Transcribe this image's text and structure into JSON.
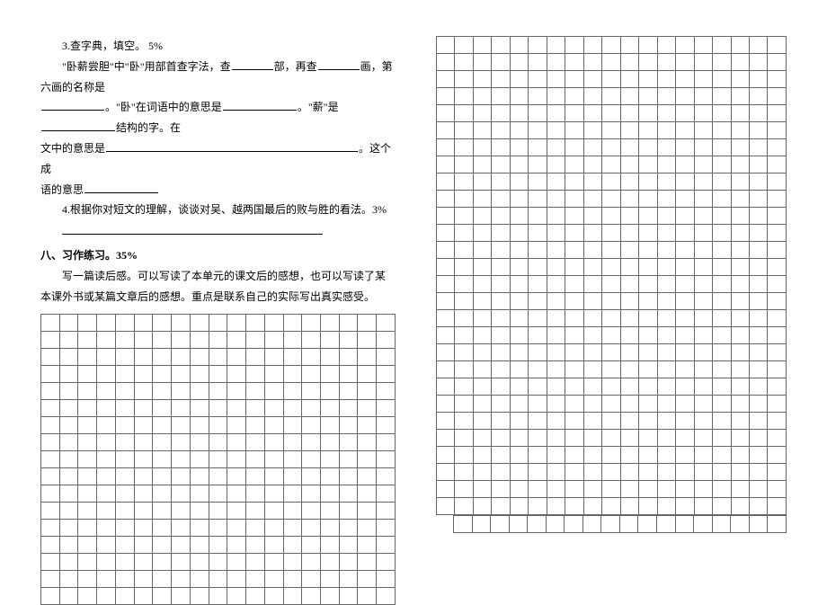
{
  "q3": {
    "label": "3.查字典，填空。 5%",
    "line1a": "\"卧薪尝胆\"中\"卧\"用部首查字法，查",
    "line1b": "部，再查",
    "line1c": "画，第六画的名称是",
    "line2a": "。\"卧\"在词语中的意思是",
    "line2b": "。\"薪\"是",
    "line2c": "结构的字。在",
    "line3a": "文中的意思是",
    "line3b": "。这个成",
    "line4": "语的意思"
  },
  "q4": {
    "label": "4.根据你对短文的理解，谈谈对吴、越两国最后的败与胜的看法。3%"
  },
  "section8": {
    "heading": "八、习作练习。35%",
    "body": "写一篇读后感。可以写读了本单元的课文后的感想，也可以写读了某本课外书或某篇文章后的感想。重点是联系自己的实际写出真实感受。"
  },
  "grids": {
    "left_cols": 19,
    "left_rows": 17,
    "right_cols": 19,
    "right_rows": 28,
    "right2_cols": 18,
    "right2_rows": 1
  }
}
